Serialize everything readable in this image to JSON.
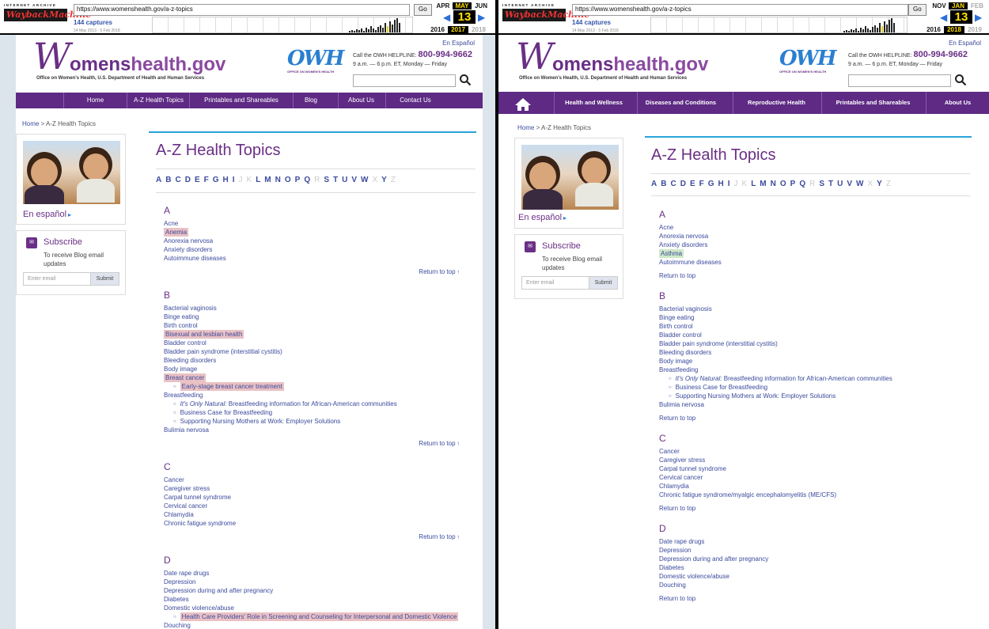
{
  "left": {
    "wayback": {
      "logo_top": "INTERNET ARCHIVE",
      "logo_main": "WaybackMachine",
      "url": "https://www.womenshealth.gov/a-z-topics",
      "go": "Go",
      "captures": "144 captures",
      "range": "14 May 2013 - 5 Feb 2018",
      "months": [
        "APR",
        "MAY",
        "JUN"
      ],
      "day": "13",
      "years": [
        "2016",
        "2017",
        "2018"
      ]
    },
    "site": {
      "logo_w": "W",
      "logo_rest_a": "omens",
      "logo_rest_b": "health.gov",
      "logo_sub": "Office on Women's Health, U.S. Department of Health and Human Services",
      "owh_mark": "OWH",
      "owh_sub": "OFFICE ON WOMEN'S HEALTH",
      "espanol": "En Español",
      "helpline_label": "Call the OWH HELPLINE:",
      "helpline_number": "800-994-9662",
      "helpline_hours": "9 a.m. — 6 p.m. ET, Monday — Friday",
      "nav": [
        "Home",
        "A-Z Health Topics",
        "Printables and Shareables",
        "Blog",
        "About Us",
        "Contact Us"
      ],
      "breadcrumb_home": "Home",
      "breadcrumb_sep": ">",
      "breadcrumb_current": "A-Z Health Topics",
      "sidebar_espanol": "En español",
      "subscribe_title": "Subscribe",
      "subscribe_desc1": "To receive Blog email",
      "subscribe_desc2": "updates",
      "email_placeholder": "Enter email",
      "submit": "Submit",
      "page_title": "A-Z Health Topics",
      "alphabet": [
        "A",
        "B",
        "C",
        "D",
        "E",
        "F",
        "G",
        "H",
        "I",
        "J",
        "K",
        "L",
        "M",
        "N",
        "O",
        "P",
        "Q",
        "R",
        "S",
        "T",
        "U",
        "V",
        "W",
        "X",
        "Y",
        "Z"
      ],
      "alphabet_disabled": [
        "J",
        "K",
        "R",
        "X",
        "Z"
      ],
      "return_top": "Return to top",
      "sections": [
        {
          "letter": "A",
          "items": [
            {
              "text": "Acne"
            },
            {
              "text": "Anemia",
              "hl": "red"
            },
            {
              "text": "Anorexia nervosa"
            },
            {
              "text": "Anxiety disorders"
            },
            {
              "text": "Autoimmune diseases"
            }
          ]
        },
        {
          "letter": "B",
          "items": [
            {
              "text": "Bacterial vaginosis"
            },
            {
              "text": "Binge eating"
            },
            {
              "text": "Birth control"
            },
            {
              "text": "Bisexual and lesbian health",
              "hl": "red"
            },
            {
              "text": "Bladder control"
            },
            {
              "text": "Bladder pain syndrome (interstitial cystitis)"
            },
            {
              "text": "Bleeding disorders"
            },
            {
              "text": "Body image"
            },
            {
              "text": "Breast cancer",
              "hl": "red"
            },
            {
              "text": "Early-stage breast cancer treatment",
              "sub": true,
              "hl": "red"
            },
            {
              "text": "Breastfeeding"
            },
            {
              "italic": "It's Only Natural:",
              "text": " Breastfeeding information for African-American communities",
              "sub": true
            },
            {
              "text": "Business Case for Breastfeeding",
              "sub": true
            },
            {
              "text": "Supporting Nursing Mothers at Work: Employer Solutions",
              "sub": true
            },
            {
              "text": "Bulimia nervosa"
            }
          ]
        },
        {
          "letter": "C",
          "items": [
            {
              "text": "Cancer"
            },
            {
              "text": "Caregiver stress"
            },
            {
              "text": "Carpal tunnel syndrome"
            },
            {
              "text": "Cervical cancer"
            },
            {
              "text": "Chlamydia"
            },
            {
              "text": "Chronic fatigue syndrome"
            }
          ]
        },
        {
          "letter": "D",
          "items": [
            {
              "text": "Date rape drugs"
            },
            {
              "text": "Depression"
            },
            {
              "text": "Depression during and after pregnancy"
            },
            {
              "text": "Diabetes"
            },
            {
              "text": "Domestic violence/abuse"
            },
            {
              "text": "Health Care Providers' Role in Screening and Counseling for Interpersonal and Domestic Violence",
              "sub": true,
              "hl": "red"
            },
            {
              "text": "Douching"
            }
          ]
        }
      ]
    }
  },
  "right": {
    "wayback": {
      "logo_top": "INTERNET ARCHIVE",
      "logo_main": "WaybackMachine",
      "url": "https://www.womenshealth.gov/a-z-topics",
      "go": "Go",
      "captures": "144 captures",
      "range": "14 May 2013 - 5 Feb 2018",
      "months": [
        "NOV",
        "JAN",
        "FEB"
      ],
      "day": "13",
      "years": [
        "2016",
        "2018",
        "2019"
      ]
    },
    "site": {
      "logo_w": "W",
      "logo_rest_a": "omens",
      "logo_rest_b": "health.gov",
      "logo_sub": "Office on Women's Health, U.S. Department of Health and Human Services",
      "owh_mark": "OWH",
      "owh_sub": "OFFICE ON WOMEN'S HEALTH",
      "espanol": "En Español",
      "helpline_label": "Call the OWH HELPLINE:",
      "helpline_number": "800-994-9662",
      "helpline_hours": "9 a.m. — 6 p.m. ET, Monday — Friday",
      "nav": [
        "Health and Wellness",
        "Diseases and Conditions",
        "Reproductive Health",
        "Printables and Shareables",
        "About Us"
      ],
      "breadcrumb_home": "Home",
      "breadcrumb_sep": ">",
      "breadcrumb_current": "A-Z Health Topics",
      "sidebar_espanol": "En español",
      "subscribe_title": "Subscribe",
      "subscribe_desc1": "To receive Blog email",
      "subscribe_desc2": "updates",
      "email_placeholder": "Enter email",
      "submit": "Submit",
      "page_title": "A-Z Health Topics",
      "alphabet": [
        "A",
        "B",
        "C",
        "D",
        "E",
        "F",
        "G",
        "H",
        "I",
        "J",
        "K",
        "L",
        "M",
        "N",
        "O",
        "P",
        "Q",
        "R",
        "S",
        "T",
        "U",
        "V",
        "W",
        "X",
        "Y",
        "Z"
      ],
      "alphabet_disabled": [
        "J",
        "K",
        "R",
        "X",
        "Z"
      ],
      "return_top": "Return to top",
      "sections": [
        {
          "letter": "A",
          "items": [
            {
              "text": "Acne"
            },
            {
              "text": "Anorexia nervosa"
            },
            {
              "text": "Anxiety disorders"
            },
            {
              "text": "Asthma",
              "hl": "green"
            },
            {
              "text": "Autoimmune diseases"
            }
          ]
        },
        {
          "letter": "B",
          "items": [
            {
              "text": "Bacterial vaginosis"
            },
            {
              "text": "Binge eating"
            },
            {
              "text": "Birth control"
            },
            {
              "text": "Bladder control"
            },
            {
              "text": "Bladder pain syndrome (interstitial cystitis)"
            },
            {
              "text": "Bleeding disorders"
            },
            {
              "text": "Body image"
            },
            {
              "text": "Breastfeeding"
            },
            {
              "italic": "It's Only Natural:",
              "text": " Breastfeeding information for African-American communities",
              "sub": true
            },
            {
              "text": "Business Case for Breastfeeding",
              "sub": true
            },
            {
              "text": "Supporting Nursing Mothers at Work: Employer Solutions",
              "sub": true
            },
            {
              "text": "Bulimia nervosa"
            }
          ]
        },
        {
          "letter": "C",
          "items": [
            {
              "text": "Cancer"
            },
            {
              "text": "Caregiver stress"
            },
            {
              "text": "Carpal tunnel syndrome"
            },
            {
              "text": "Cervical cancer"
            },
            {
              "text": "Chlamydia"
            },
            {
              "text": "Chronic fatigue syndrome/myalgic encephalomyelitis (ME/CFS)"
            }
          ]
        },
        {
          "letter": "D",
          "items": [
            {
              "text": "Date rape drugs"
            },
            {
              "text": "Depression"
            },
            {
              "text": "Depression during and after pregnancy"
            },
            {
              "text": "Diabetes"
            },
            {
              "text": "Domestic violence/abuse"
            },
            {
              "text": "Douching"
            }
          ]
        }
      ]
    }
  }
}
